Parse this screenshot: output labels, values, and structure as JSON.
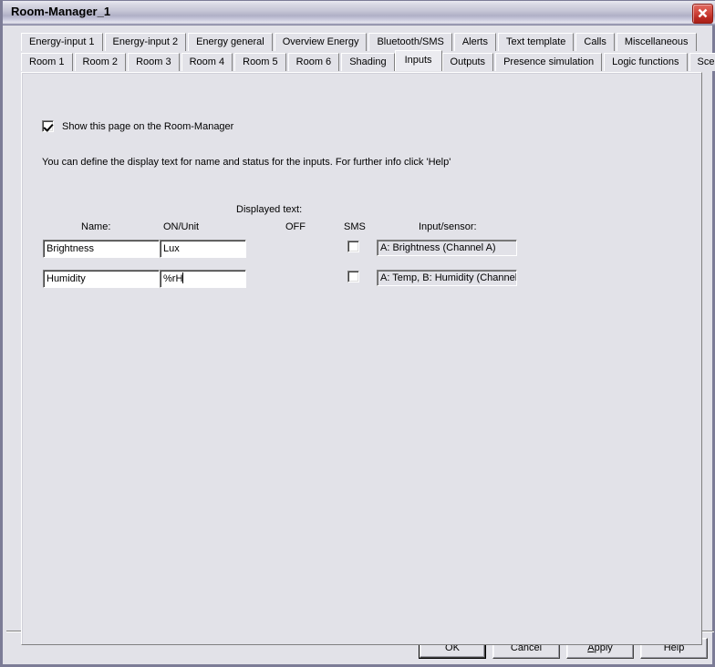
{
  "window": {
    "title": "Room-Manager_1",
    "close_icon": "close-icon",
    "accent_close": "#c02a20",
    "face_color": "#e2e2e8"
  },
  "tabs": {
    "row1": [
      {
        "label": "Energy-input 1",
        "selected": false
      },
      {
        "label": "Energy-input 2",
        "selected": false
      },
      {
        "label": "Energy general",
        "selected": false
      },
      {
        "label": "Overview Energy",
        "selected": false
      },
      {
        "label": "Bluetooth/SMS",
        "selected": false
      },
      {
        "label": "Alerts",
        "selected": false
      },
      {
        "label": "Text template",
        "selected": false
      },
      {
        "label": "Calls",
        "selected": false
      },
      {
        "label": "Miscellaneous",
        "selected": false
      }
    ],
    "row2": [
      {
        "label": "Room 1",
        "selected": false
      },
      {
        "label": "Room 2",
        "selected": false
      },
      {
        "label": "Room 3",
        "selected": false
      },
      {
        "label": "Room 4",
        "selected": false
      },
      {
        "label": "Room 5",
        "selected": false
      },
      {
        "label": "Room 6",
        "selected": false
      },
      {
        "label": "Shading",
        "selected": false
      },
      {
        "label": "Inputs",
        "selected": true
      },
      {
        "label": "Outputs",
        "selected": false
      },
      {
        "label": "Presence simulation",
        "selected": false
      },
      {
        "label": "Logic functions",
        "selected": false
      },
      {
        "label": "Scenes",
        "selected": false
      }
    ]
  },
  "panel": {
    "show_page_checkbox": {
      "label": "Show this page on the Room-Manager",
      "checked": true
    },
    "description": "You can define the display text for name and status for the inputs. For further info click 'Help'",
    "headers": {
      "displayed_text": "Displayed text:",
      "name": "Name:",
      "on_unit": "ON/Unit",
      "off": "OFF",
      "sms": "SMS",
      "input_sensor": "Input/sensor:"
    },
    "rows": [
      {
        "name": "Brightness",
        "on_unit": "Lux",
        "off": "",
        "sms_checked": false,
        "input_sensor": "A: Brightness  (Channel A)",
        "focused": false
      },
      {
        "name": "Humidity",
        "on_unit": "%rH",
        "off": "",
        "sms_checked": false,
        "input_sensor": "A: Temp, B: Humidity  (Channel",
        "focused": true
      }
    ]
  },
  "buttons": {
    "ok": "OK",
    "cancel": "Cancel",
    "apply_pre": "A",
    "apply_post": "pply",
    "help": "Help"
  }
}
